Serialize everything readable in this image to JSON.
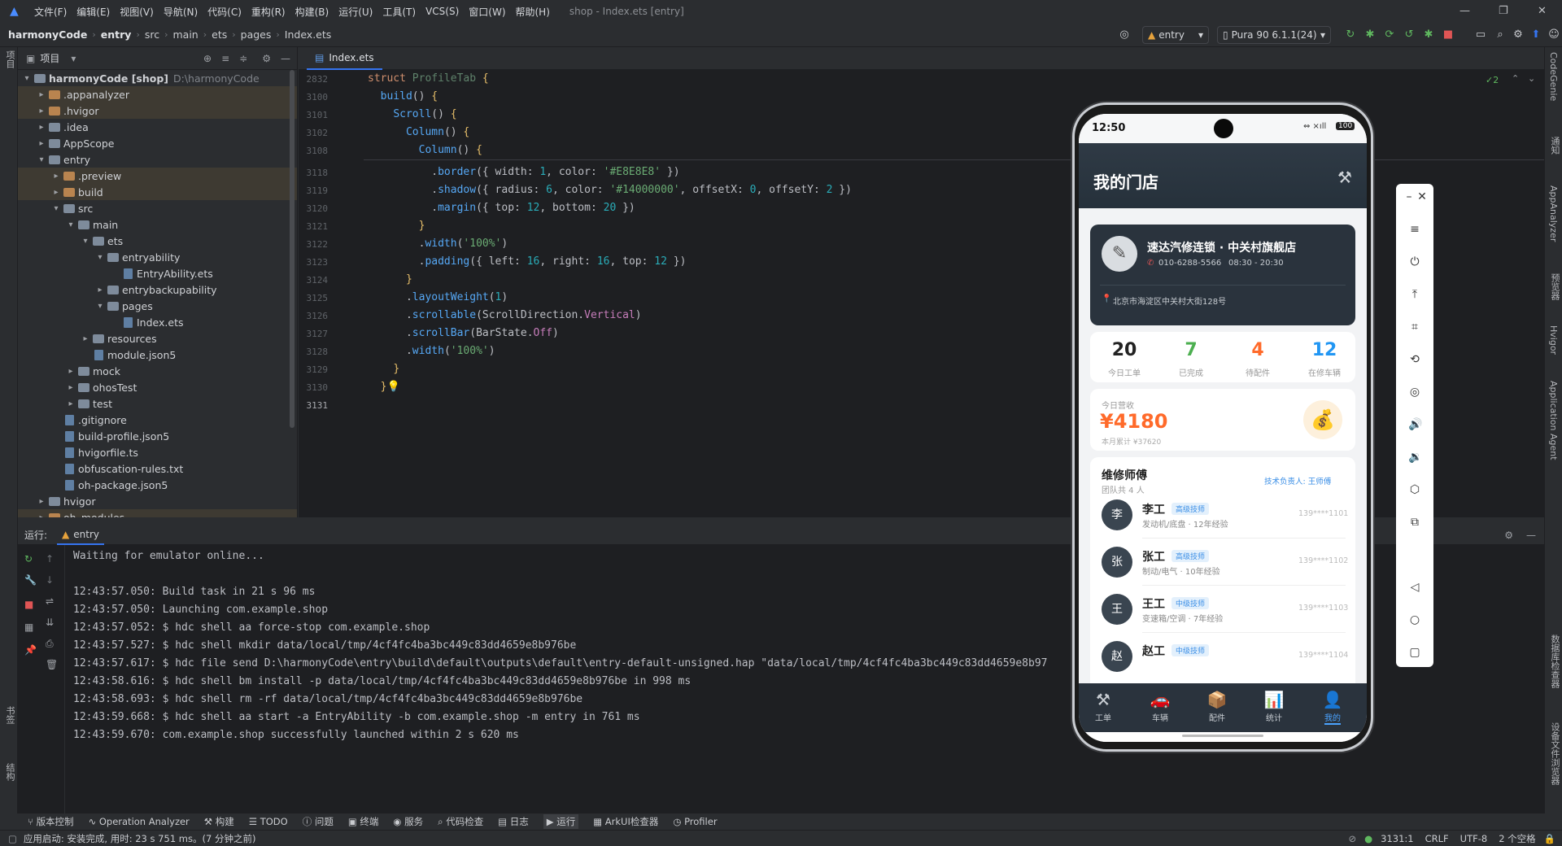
{
  "menubar": {
    "items": [
      "文件(F)",
      "编辑(E)",
      "视图(V)",
      "导航(N)",
      "代码(C)",
      "重构(R)",
      "构建(B)",
      "运行(U)",
      "工具(T)",
      "VCS(S)",
      "窗口(W)",
      "帮助(H)"
    ],
    "window_title": "shop - Index.ets [entry]"
  },
  "breadcrumb": [
    "harmonyCode",
    "entry",
    "src",
    "main",
    "ets",
    "pages",
    "Index.ets"
  ],
  "toolbar": {
    "module": "entry",
    "device": "Pura 90 6.1.1(24)"
  },
  "project": {
    "header": "项目",
    "root": "harmonyCode [shop]",
    "root_path": "D:\\harmonyCode",
    "tree": [
      {
        "label": ".appanalyzer",
        "depth": 1,
        "kind": "folder-o",
        "arrow": "▸",
        "hl": true
      },
      {
        "label": ".hvigor",
        "depth": 1,
        "kind": "folder-o",
        "arrow": "▸",
        "hl": true
      },
      {
        "label": ".idea",
        "depth": 1,
        "kind": "folder",
        "arrow": "▸",
        "hl": false
      },
      {
        "label": "AppScope",
        "depth": 1,
        "kind": "folder",
        "arrow": "▸",
        "hl": false
      },
      {
        "label": "entry",
        "depth": 1,
        "kind": "folder",
        "arrow": "▾",
        "hl": false
      },
      {
        "label": ".preview",
        "depth": 2,
        "kind": "folder-o",
        "arrow": "▸",
        "hl": true
      },
      {
        "label": "build",
        "depth": 2,
        "kind": "folder-o",
        "arrow": "▸",
        "hl": true
      },
      {
        "label": "src",
        "depth": 2,
        "kind": "folder",
        "arrow": "▾",
        "hl": false
      },
      {
        "label": "main",
        "depth": 3,
        "kind": "folder",
        "arrow": "▾",
        "hl": false
      },
      {
        "label": "ets",
        "depth": 4,
        "kind": "folder",
        "arrow": "▾",
        "hl": false
      },
      {
        "label": "entryability",
        "depth": 5,
        "kind": "folder",
        "arrow": "▾",
        "hl": false
      },
      {
        "label": "EntryAbility.ets",
        "depth": 6,
        "kind": "file",
        "arrow": "",
        "hl": false
      },
      {
        "label": "entrybackupability",
        "depth": 5,
        "kind": "folder",
        "arrow": "▸",
        "hl": false
      },
      {
        "label": "pages",
        "depth": 5,
        "kind": "folder",
        "arrow": "▾",
        "hl": false
      },
      {
        "label": "Index.ets",
        "depth": 6,
        "kind": "file",
        "arrow": "",
        "hl": false
      },
      {
        "label": "resources",
        "depth": 4,
        "kind": "folder",
        "arrow": "▸",
        "hl": false
      },
      {
        "label": "module.json5",
        "depth": 4,
        "kind": "file",
        "arrow": "",
        "hl": false
      },
      {
        "label": "mock",
        "depth": 3,
        "kind": "folder",
        "arrow": "▸",
        "hl": false
      },
      {
        "label": "ohosTest",
        "depth": 3,
        "kind": "folder",
        "arrow": "▸",
        "hl": false
      },
      {
        "label": "test",
        "depth": 3,
        "kind": "folder",
        "arrow": "▸",
        "hl": false
      },
      {
        "label": ".gitignore",
        "depth": 2,
        "kind": "file",
        "arrow": "",
        "hl": false
      },
      {
        "label": "build-profile.json5",
        "depth": 2,
        "kind": "file",
        "arrow": "",
        "hl": false
      },
      {
        "label": "hvigorfile.ts",
        "depth": 2,
        "kind": "file",
        "arrow": "",
        "hl": false
      },
      {
        "label": "obfuscation-rules.txt",
        "depth": 2,
        "kind": "file",
        "arrow": "",
        "hl": false
      },
      {
        "label": "oh-package.json5",
        "depth": 2,
        "kind": "file",
        "arrow": "",
        "hl": false
      },
      {
        "label": "hvigor",
        "depth": 1,
        "kind": "folder",
        "arrow": "▸",
        "hl": false
      },
      {
        "label": "oh_modules",
        "depth": 1,
        "kind": "folder-o",
        "arrow": "▸",
        "hl": true
      }
    ]
  },
  "editor": {
    "tab": "Index.ets",
    "inspection": "✓2",
    "line_numbers": [
      "2832",
      "3100",
      "3101",
      "3102",
      "3108",
      "3118",
      "3119",
      "3120",
      "3121",
      "3122",
      "3123",
      "3124",
      "3125",
      "3126",
      "3127",
      "3128",
      "3129",
      "3130",
      "3131"
    ]
  },
  "run": {
    "label": "运行:",
    "tab": "entry",
    "log": [
      "Waiting for emulator online...",
      "",
      "12:43:57.050: Build task in 21 s 96 ms",
      "12:43:57.050: Launching com.example.shop",
      "12:43:57.052: $ hdc shell aa force-stop com.example.shop",
      "12:43:57.527: $ hdc shell mkdir data/local/tmp/4cf4fc4ba3bc449c83dd4659e8b976be",
      "12:43:57.617: $ hdc file send D:\\harmonyCode\\entry\\build\\default\\outputs\\default\\entry-default-unsigned.hap \"data/local/tmp/4cf4fc4ba3bc449c83dd4659e8b97",
      "12:43:58.616: $ hdc shell bm install -p data/local/tmp/4cf4fc4ba3bc449c83dd4659e8b976be in 998 ms",
      "12:43:58.693: $ hdc shell rm -rf data/local/tmp/4cf4fc4ba3bc449c83dd4659e8b976be",
      "12:43:59.668: $ hdc shell aa start -a EntryAbility -b com.example.shop -m entry in 761 ms",
      "12:43:59.670: com.example.shop successfully launched within 2 s 620 ms"
    ]
  },
  "bottom_tools": [
    "版本控制",
    "Operation Analyzer",
    "构建",
    "TODO",
    "问题",
    "终端",
    "服务",
    "代码检查",
    "日志",
    "运行",
    "ArkUI检查器",
    "Profiler"
  ],
  "status": {
    "message": "应用启动: 安装完成, 用时: 23 s 751 ms。(7 分钟之前)",
    "position": "3131:1",
    "line_sep": "CRLF",
    "encoding": "UTF-8",
    "indent": "2 个空格"
  },
  "left_strip": [
    "项目",
    "书签",
    "结构"
  ],
  "right_strip": [
    "CodeGenie",
    "通知",
    "AppAnalyzer",
    "预览器",
    "Hvigor",
    "Application Agent",
    "数据库检查器",
    "设备文件浏览器"
  ],
  "phone": {
    "time": "12:50",
    "battery": "100",
    "title": "我的门店",
    "shop": {
      "name": "速达汽修连锁 · 中关村旗舰店",
      "phone": "010-6288-5566",
      "hours": "08:30 - 20:30",
      "address": "北京市海淀区中关村大街128号"
    },
    "stats": [
      {
        "value": "20",
        "label": "今日工单",
        "color": "#222222"
      },
      {
        "value": "7",
        "label": "已完成",
        "color": "#4caf50"
      },
      {
        "value": "4",
        "label": "待配件",
        "color": "#ff6a2a"
      },
      {
        "value": "12",
        "label": "在修车辆",
        "color": "#2196f3"
      }
    ],
    "revenue": {
      "label": "今日营收",
      "value": "¥4180",
      "month": "本月累计 ¥37620"
    },
    "mechanics": {
      "title": "维修师傅",
      "count": "团队共 4 人",
      "lead": "技术负责人: 王师傅",
      "list": [
        {
          "avatar": "李",
          "name": "李工",
          "badge": "高级技师",
          "desc": "发动机/底盘 · 12年经验",
          "phone": "139****1101"
        },
        {
          "avatar": "张",
          "name": "张工",
          "badge": "高级技师",
          "desc": "制动/电气 · 10年经验",
          "phone": "139****1102"
        },
        {
          "avatar": "王",
          "name": "王工",
          "badge": "中级技师",
          "desc": "变速箱/空调 · 7年经验",
          "phone": "139****1103"
        },
        {
          "avatar": "赵",
          "name": "赵工",
          "badge": "中级技师",
          "desc": "",
          "phone": "139****1104"
        }
      ]
    },
    "tabs": [
      "工单",
      "车辆",
      "配件",
      "统计",
      "我的"
    ],
    "active_tab": "我的"
  }
}
